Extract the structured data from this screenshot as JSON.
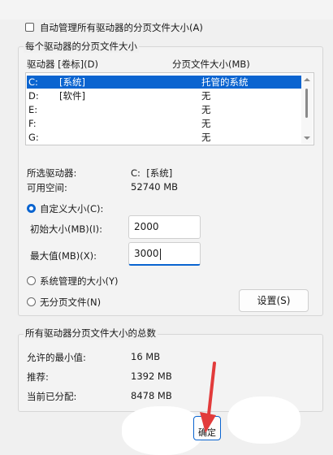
{
  "auto_manage_checkbox": {
    "label": "自动管理所有驱动器的分页文件大小(A)",
    "checked": false
  },
  "per_drive_group": {
    "title": "每个驱动器的分页文件大小",
    "column_drive": "驱动器 [卷标](D)",
    "column_size": "分页文件大小(MB)",
    "rows": [
      {
        "drive": "C:",
        "label": "[系统]",
        "size": "托管的系统",
        "selected": true
      },
      {
        "drive": "D:",
        "label": "[软件]",
        "size": "无",
        "selected": false
      },
      {
        "drive": "E:",
        "label": "",
        "size": "无",
        "selected": false
      },
      {
        "drive": "F:",
        "label": "",
        "size": "无",
        "selected": false
      },
      {
        "drive": "G:",
        "label": "",
        "size": "无",
        "selected": false
      }
    ],
    "selected_drive_label": "所选驱动器:",
    "selected_drive_value": "C:  [系统]",
    "free_space_label": "可用空间:",
    "free_space_value": "52740 MB",
    "custom_size_radio": "自定义大小(C):",
    "initial_size_label": "初始大小(MB)(I):",
    "initial_size_value": "2000",
    "max_size_label": "最大值(MB)(X):",
    "max_size_value": "3000",
    "system_managed_radio": "系统管理的大小(Y)",
    "no_paging_radio": "无分页文件(N)",
    "selected_radio": "custom",
    "set_button": "设置(S)"
  },
  "total_group": {
    "title": "所有驱动器分页文件大小的总数",
    "min_label": "允许的最小值:",
    "min_value": "16 MB",
    "recommended_label": "推荐:",
    "recommended_value": "1392 MB",
    "current_label": "当前已分配:",
    "current_value": "8478 MB"
  },
  "ok_button": "确定",
  "colors": {
    "selection": "#0a64d0",
    "annotation_arrow": "#e23b3b"
  }
}
